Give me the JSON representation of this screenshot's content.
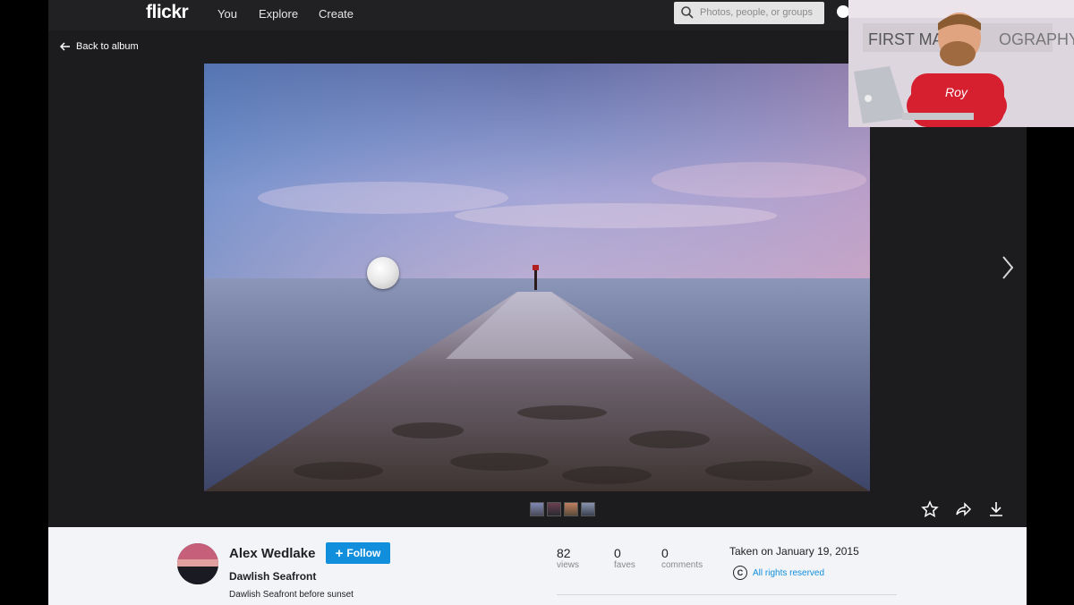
{
  "nav": {
    "logo": "flickr",
    "links": [
      "You",
      "Explore",
      "Create"
    ],
    "search_placeholder": "Photos, people, or groups"
  },
  "back_link": "Back to album",
  "photo": {
    "subject": "long exposure of a stone jetty leading into the sea under a pink and blue sky"
  },
  "thumbnails": 4,
  "actions": [
    "star-icon",
    "share-icon",
    "download-icon"
  ],
  "info": {
    "author": "Alex Wedlake",
    "follow_label": "Follow",
    "title": "Dawlish Seafront",
    "description": "Dawlish Seafront before sunset",
    "stats": [
      {
        "value": "82",
        "label": "views"
      },
      {
        "value": "0",
        "label": "faves"
      },
      {
        "value": "0",
        "label": "comments"
      }
    ],
    "taken": "Taken on January 19, 2015",
    "rights": "All rights reserved",
    "rights_symbol": "C"
  },
  "webcam": {
    "sign_left": "FIRST MAN",
    "sign_right": "OGRAPHY",
    "shirt_text": "Roy"
  },
  "colors": {
    "nav_bg": "#212124",
    "page_bg": "#1c1c1e",
    "panel_bg": "#f2f4f7",
    "accent": "#128fdc"
  }
}
